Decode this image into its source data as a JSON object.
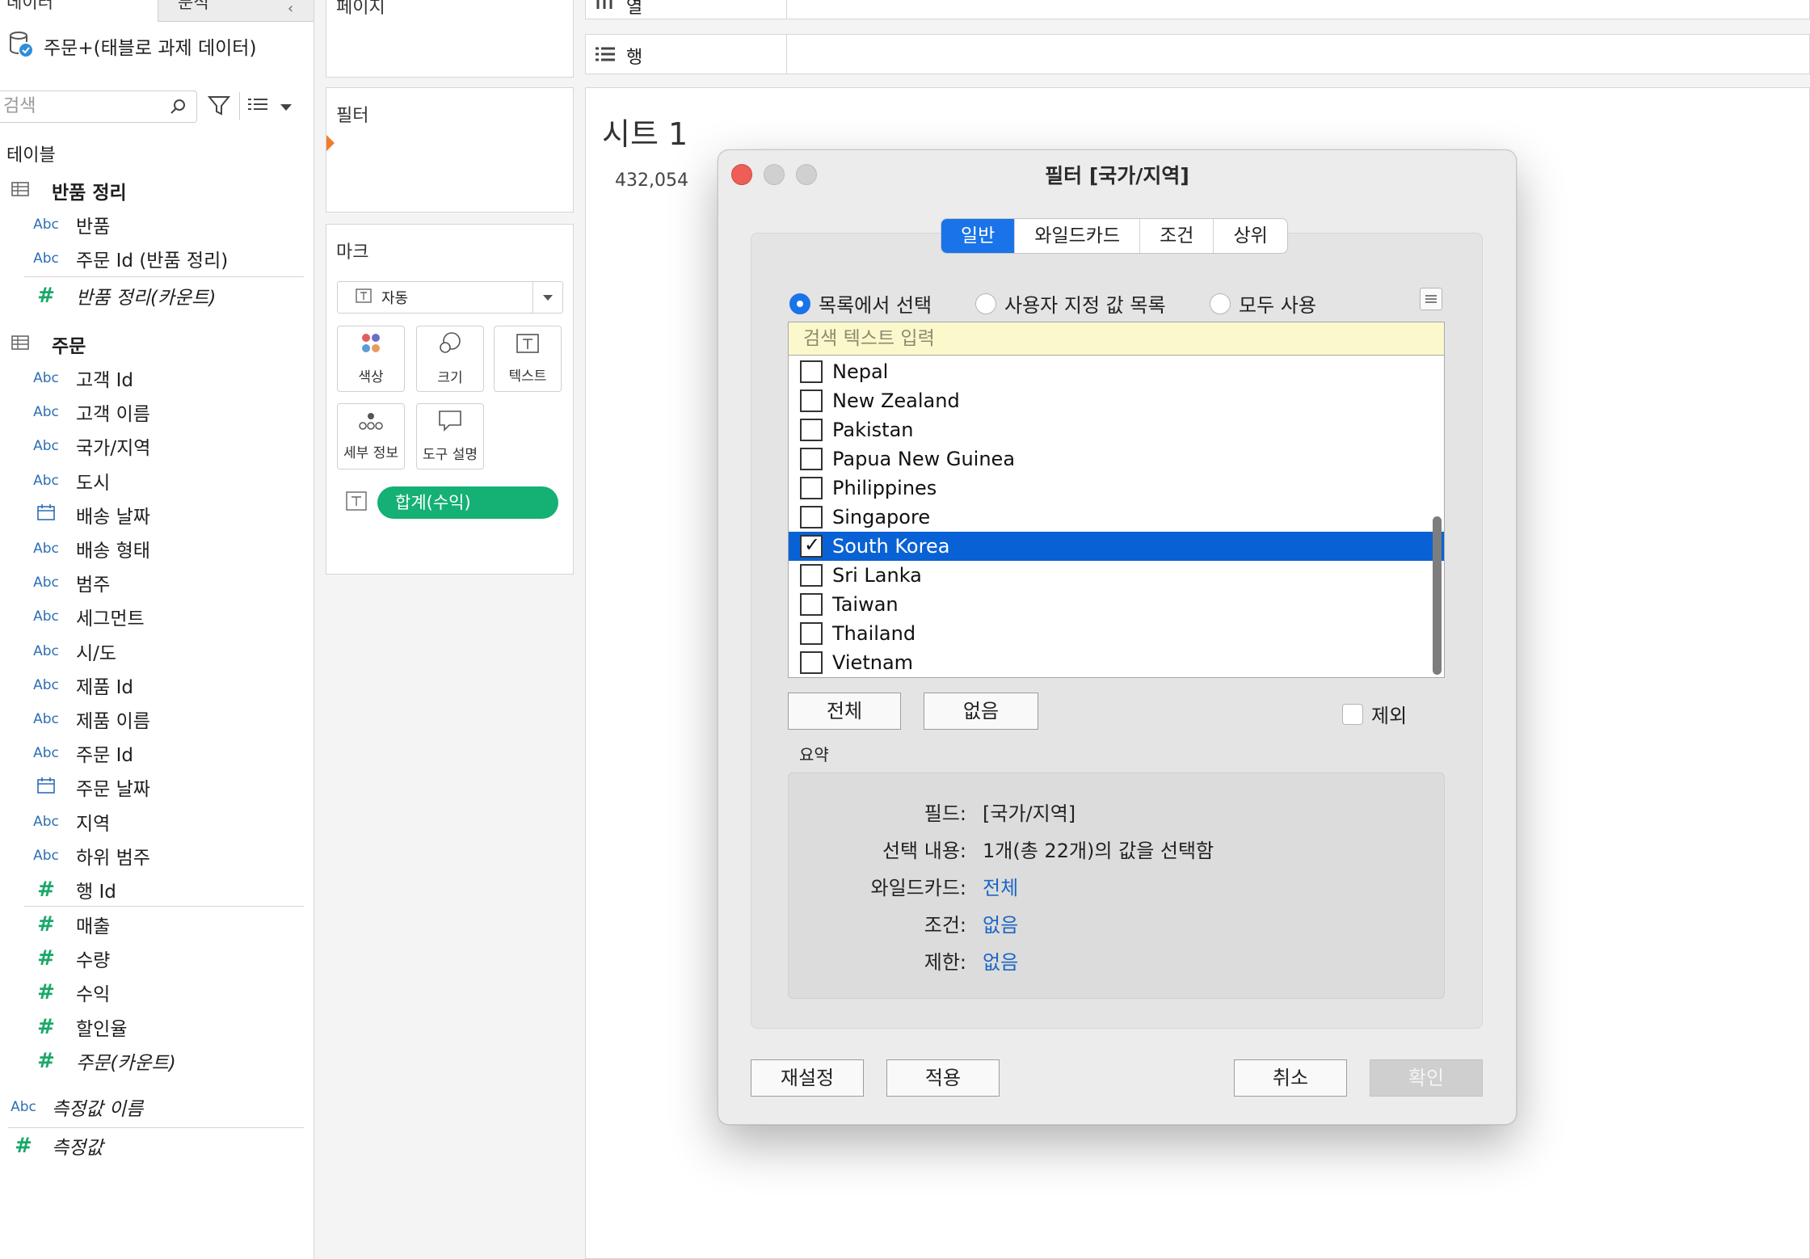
{
  "left_pane": {
    "tab_data": "데이터",
    "tab_analysis": "분석",
    "datasource": "주문+(태블로 과제 데이터)",
    "search_placeholder": "검색",
    "tables_header": "테이블",
    "table_returns": {
      "name": "반품 정리",
      "fields": [
        {
          "type": "Abc",
          "name": "반품"
        },
        {
          "type": "Abc",
          "name": "주문 Id (반품 정리)"
        },
        {
          "type": "#",
          "name": "반품 정리(카운트)"
        }
      ]
    },
    "table_orders": {
      "name": "주문",
      "dimensions": [
        {
          "type": "Abc",
          "name": "고객 Id"
        },
        {
          "type": "Abc",
          "name": "고객 이름"
        },
        {
          "type": "Abc",
          "name": "국가/지역"
        },
        {
          "type": "Abc",
          "name": "도시"
        },
        {
          "type": "date",
          "name": "배송 날짜"
        },
        {
          "type": "Abc",
          "name": "배송 형태"
        },
        {
          "type": "Abc",
          "name": "범주"
        },
        {
          "type": "Abc",
          "name": "세그먼트"
        },
        {
          "type": "Abc",
          "name": "시/도"
        },
        {
          "type": "Abc",
          "name": "제품 Id"
        },
        {
          "type": "Abc",
          "name": "제품 이름"
        },
        {
          "type": "Abc",
          "name": "주문 Id"
        },
        {
          "type": "date",
          "name": "주문 날짜"
        },
        {
          "type": "Abc",
          "name": "지역"
        },
        {
          "type": "Abc",
          "name": "하위 범주"
        },
        {
          "type": "#",
          "name": "행 Id"
        }
      ],
      "measures": [
        {
          "type": "#",
          "name": "매출"
        },
        {
          "type": "#",
          "name": "수량"
        },
        {
          "type": "#",
          "name": "수익"
        },
        {
          "type": "#",
          "name": "할인율"
        },
        {
          "type": "#",
          "name": "주문(카운트)"
        }
      ]
    },
    "measure_names": {
      "type": "Abc",
      "name": "측정값 이름"
    },
    "measure_values": {
      "type": "#",
      "name": "측정값"
    }
  },
  "middle_pane": {
    "pages_title": "페이지",
    "filters_title": "필터",
    "marks_title": "마크",
    "mark_type": "자동",
    "mark_buttons": [
      {
        "label": "색상",
        "icon": "color-icon"
      },
      {
        "label": "크기",
        "icon": "size-icon"
      },
      {
        "label": "텍스트",
        "icon": "text-icon"
      },
      {
        "label": "세부 정보",
        "icon": "detail-icon"
      },
      {
        "label": "도구 설명",
        "icon": "tooltip-icon"
      }
    ],
    "pill": "합계(수익)"
  },
  "shelves": {
    "columns_label": "열",
    "rows_label": "행"
  },
  "sheet": {
    "title": "시트 1",
    "value": "432,054"
  },
  "dialog": {
    "title": "필터 [국가/지역]",
    "tabs": [
      "일반",
      "와일드카드",
      "조건",
      "상위"
    ],
    "active_tab": "일반",
    "radios": [
      "목록에서 선택",
      "사용자 지정 값 목록",
      "모두 사용"
    ],
    "selected_radio": "목록에서 선택",
    "search_placeholder": "검색 텍스트 입력",
    "items": [
      {
        "name": "Nepal",
        "checked": false
      },
      {
        "name": "New Zealand",
        "checked": false
      },
      {
        "name": "Pakistan",
        "checked": false
      },
      {
        "name": "Papua New Guinea",
        "checked": false
      },
      {
        "name": "Philippines",
        "checked": false
      },
      {
        "name": "Singapore",
        "checked": false
      },
      {
        "name": "South Korea",
        "checked": true
      },
      {
        "name": "Sri Lanka",
        "checked": false
      },
      {
        "name": "Taiwan",
        "checked": false
      },
      {
        "name": "Thailand",
        "checked": false
      },
      {
        "name": "Vietnam",
        "checked": false
      }
    ],
    "all_button": "전체",
    "none_button": "없음",
    "exclude_label": "제외",
    "summary_title": "요약",
    "summary": {
      "field_label": "필드:",
      "field_value": "[국가/지역]",
      "selection_label": "선택 내용:",
      "selection_value": "1개(총 22개)의 값을 선택함",
      "wildcard_label": "와일드카드:",
      "wildcard_value": "전체",
      "condition_label": "조건:",
      "condition_value": "없음",
      "limit_label": "제한:",
      "limit_value": "없음"
    },
    "reset_button": "재설정",
    "apply_button": "적용",
    "cancel_button": "취소",
    "ok_button": "확인"
  },
  "colors": {
    "accent_blue": "#1a73e8",
    "selection_blue": "#0962d5",
    "pill_green": "#15b074",
    "field_abc_blue": "#2d6eb4",
    "measure_green": "#1aa86a",
    "traffic_red": "#ed5f56"
  }
}
